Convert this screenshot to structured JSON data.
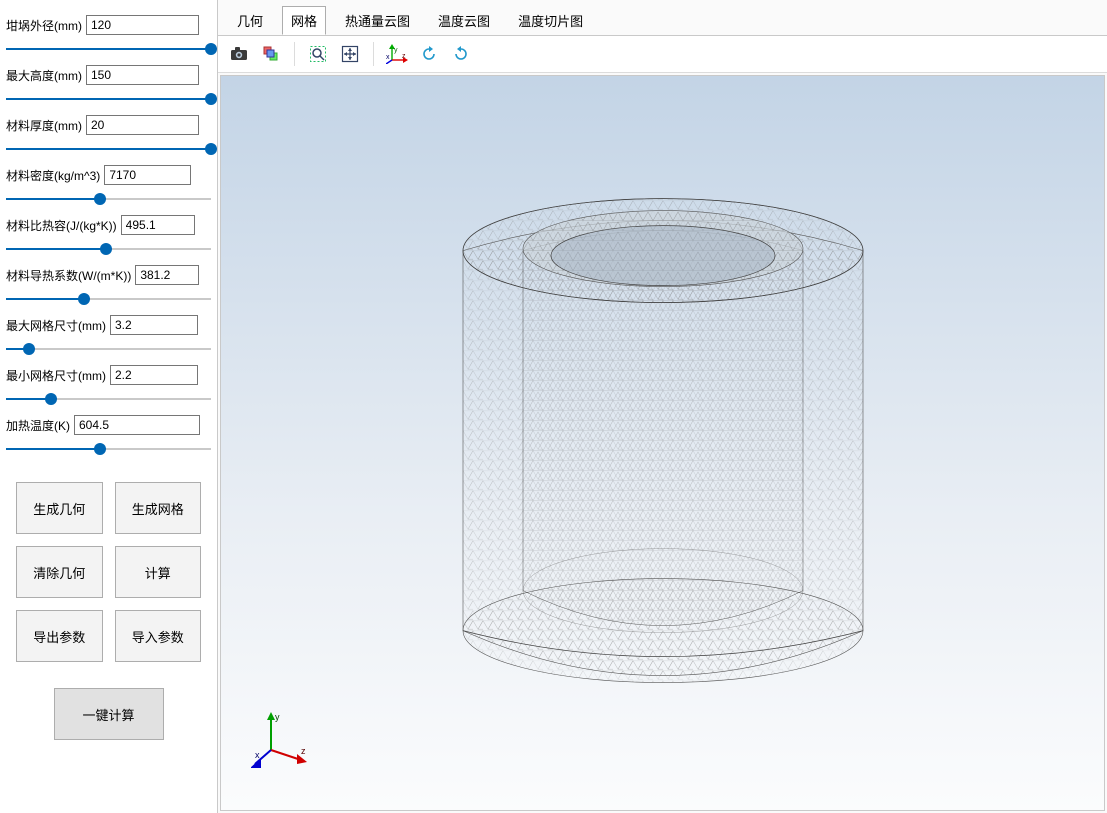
{
  "sidebar": {
    "params": [
      {
        "label": "坩埚外径(mm)",
        "value": "120",
        "fill": 100,
        "input_width": 103
      },
      {
        "label": "最大高度(mm)",
        "value": "150",
        "fill": 100,
        "input_width": 103
      },
      {
        "label": "材料厚度(mm)",
        "value": "20",
        "fill": 100,
        "input_width": 103
      },
      {
        "label": "材料密度(kg/m^3)",
        "value": "7170",
        "fill": 46,
        "input_width": 77
      },
      {
        "label": "材料比热容(J/(kg*K))",
        "value": "495.1",
        "fill": 49,
        "input_width": 64
      },
      {
        "label": "材料导热系数(W/(m*K))",
        "value": "381.2",
        "fill": 38,
        "input_width": 54
      },
      {
        "label": "最大网格尺寸(mm)",
        "value": "3.2",
        "fill": 11,
        "input_width": 78
      },
      {
        "label": "最小网格尺寸(mm)",
        "value": "2.2",
        "fill": 22,
        "input_width": 78
      },
      {
        "label": "加热温度(K)",
        "value": "604.5",
        "fill": 46,
        "input_width": 116
      }
    ],
    "buttons": [
      "生成几何",
      "生成网格",
      "清除几何",
      "计算",
      "导出参数",
      "导入参数"
    ],
    "main_button": "一键计算"
  },
  "tabs": {
    "items": [
      "几何",
      "网格",
      "热通量云图",
      "温度云图",
      "温度切片图"
    ],
    "active": 1
  },
  "toolbar": {
    "items": [
      {
        "name": "camera-icon",
        "title": "截图"
      },
      {
        "name": "print-layout-icon",
        "title": "打印视图"
      },
      {
        "sep": true
      },
      {
        "name": "zoom-window-icon",
        "title": "框选缩放"
      },
      {
        "name": "zoom-extents-icon",
        "title": "缩放到全部"
      },
      {
        "sep": true
      },
      {
        "name": "default-view-icon",
        "title": "默认视角"
      },
      {
        "name": "rotate-ccw-icon",
        "title": "逆时针旋转"
      },
      {
        "name": "rotate-cw-icon",
        "title": "顺时针旋转"
      }
    ]
  },
  "axis": {
    "x": "x",
    "y": "y",
    "z": "z"
  }
}
